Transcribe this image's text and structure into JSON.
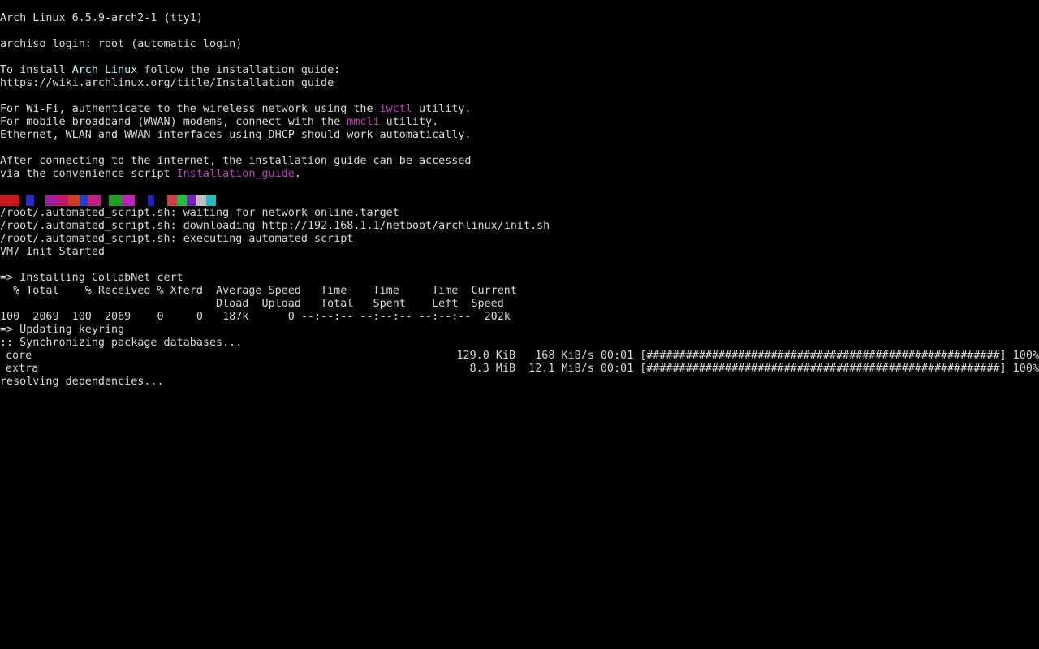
{
  "terminal": {
    "banner": "Arch Linux 6.5.9-arch2-1 (tty1)",
    "login": "archiso login: root (automatic login)",
    "install_prefix": "To install ",
    "install_highlight": "Arch Linux",
    "install_suffix": " follow the installation guide:",
    "install_url": "https://wiki.archlinux.org/title/Installation_guide",
    "wifi_prefix": "For Wi-Fi, authenticate to the wireless network using the ",
    "wifi_highlight": "iwctl",
    "wifi_suffix": " utility.",
    "wwan_prefix": "For mobile broadband (WWAN) modems, connect with the ",
    "wwan_highlight": "mmcli",
    "wwan_suffix": " utility.",
    "ethernet": "Ethernet, WLAN and WWAN interfaces using DHCP should work automatically.",
    "after_connect": "After connecting to the internet, the installation guide can be accessed",
    "via_prefix": "via the convenience script ",
    "via_highlight": "Installation_guide",
    "via_suffix": ".",
    "script_wait": "/root/.automated_script.sh: waiting for network-online.target",
    "script_download": "/root/.automated_script.sh: downloading http://192.168.1.1/netboot/archlinux/init.sh",
    "script_exec": "/root/.automated_script.sh: executing automated script",
    "init_started": "VM7 Init Started",
    "install_cert": "=> Installing CollabNet cert",
    "curl_header1": "  % Total    % Received % Xferd  Average Speed   Time    Time     Time  Current",
    "curl_header2": "                                 Dload  Upload   Total   Spent    Left  Speed",
    "curl_row": "100  2069  100  2069    0     0   187k      0 --:--:-- --:--:-- --:--:--  202k",
    "keyring": "=> Updating keyring",
    "sync": ":: Synchronizing package databases...",
    "progress": [
      {
        "name": "core",
        "stats": "129.0 KiB   168 KiB/s 00:01 [######################################################] 100%"
      },
      {
        "name": "extra",
        "stats": "8.3 MiB  12.1 MiB/s 00:01 [######################################################] 100%"
      }
    ],
    "resolving": "resolving dependencies..."
  },
  "colors": {
    "background": "#000000",
    "foreground": "#d8d8d8",
    "highlight_cyan": "#b9f4f4",
    "highlight_magenta": "#c040c0",
    "glitch_strip": [
      "#cc1a1a",
      "#000000",
      "#2a2ad0",
      "#000000",
      "#a020a0",
      "#c01a6a",
      "#d04020",
      "#2040c0",
      "#c02080",
      "#000000",
      "#20a020",
      "#c020c0",
      "#000000",
      "#2020c0",
      "#000000",
      "#d04040",
      "#20c040",
      "#8020c0",
      "#c0c0c0",
      "#20c0c0"
    ]
  }
}
